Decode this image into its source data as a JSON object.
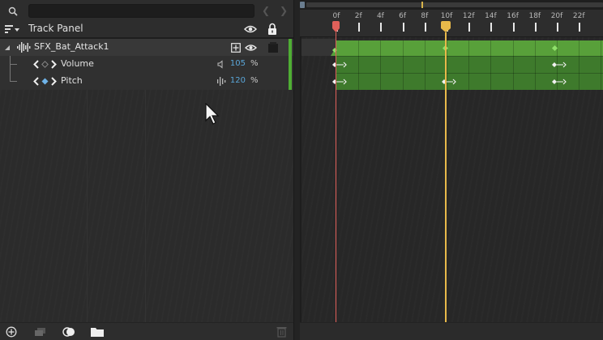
{
  "search": {
    "placeholder": "",
    "value": ""
  },
  "header": {
    "title": "Track Panel"
  },
  "track": {
    "name": "SFX_Bat_Attack1",
    "icon": "audio-wave-icon"
  },
  "properties": [
    {
      "label": "Volume",
      "value": "105",
      "unit": "%",
      "icon": "speaker-icon"
    },
    {
      "label": "Pitch",
      "value": "120",
      "unit": "%",
      "icon": "pitch-bars-icon"
    }
  ],
  "ruler": {
    "labels": [
      "0f",
      "2f",
      "4f",
      "6f",
      "8f",
      "10f",
      "12f",
      "14f",
      "16f",
      "18f",
      "20f",
      "22f"
    ]
  },
  "playheads": {
    "current_frame": "0f",
    "marker_frame": "10f"
  },
  "colors": {
    "accent_green": "#58a03a",
    "playhead_red": "#e0605a",
    "playhead_yellow": "#e8b94a",
    "value_blue": "#5aa6d8"
  }
}
